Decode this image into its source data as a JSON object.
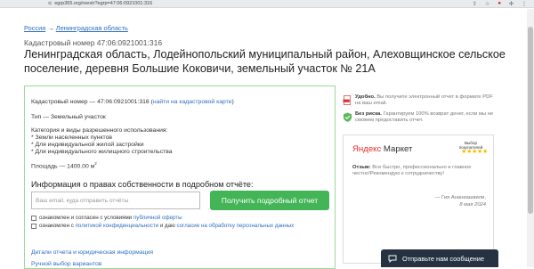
{
  "browser": {
    "url": "egrp365.org/reestr?egrp=47:06:0921001:316",
    "icons": [
      "share-icon",
      "star-icon",
      "extension-red-icon",
      "puzzle-icon",
      "menu-icon"
    ]
  },
  "breadcrumb": {
    "root": "Россия",
    "sep": "→",
    "region": "Ленинградская область"
  },
  "header": {
    "kad_label": "Кадастровый номер 47:06:0921001:316",
    "title": "Ленинградская область, Лодейнопольский муниципальный район, Алеховщинское сельское поселение, деревня Большие Коковичи, земельный участок № 21А"
  },
  "card": {
    "kad_line_prefix": "Кадастровый номер — 47:06:0921001:316 (",
    "kad_line_link": "найти на кадастровой карте",
    "kad_line_suffix": ")",
    "type": "Тип — Земельный участок",
    "category_title": "Категория и виды разрешенного использования:",
    "categories": [
      "* Земли населенных пунктов",
      "* Для индивидуальной жилой застройки",
      "* Для индивидуального жилищного строительства"
    ],
    "area_prefix": "Площадь — 1400.00 м",
    "area_sup": "2",
    "info_title": "Информация о правах собственности в подробном отчёте:",
    "email_placeholder": "Ваш email, куда отправить отчёты",
    "button": "Получить подробный отчет",
    "consent1_text": "ознакомлен и согласен с условиями ",
    "consent1_link": "публичной оферты",
    "consent2_text": "ознакомлен с ",
    "consent2_link1": "политикой конфиденциальности",
    "consent2_mid": " и даю ",
    "consent2_link2": "согласие на обработку персональных данных",
    "details_link": "Детали отчета и юридическая информация",
    "manual_link": "Ручной выбор вариантов"
  },
  "sidebar": {
    "feature1_bold": "Удобно.",
    "feature1_text": " Вы получите электронный отчет в формате PDF на ваш email.",
    "feature2_bold": "Без риска.",
    "feature2_text": " Гарантируем 100% возврат денег, если мы не сможем предоставить отчет.",
    "market": {
      "logo_y": "Яндекс",
      "logo_rest": " Маркет",
      "choice": "Выбор покупателей",
      "stars": "★★★★★",
      "review_bold": "Отзыв:",
      "review_text": " Все быстро, профессионально и главное честно!Рекомендую к сотрудничеству!",
      "author": "— Гия Ананиашвили,",
      "date": "8 мая 2024"
    }
  },
  "chat": {
    "label": "Отправьте нам сообщение"
  },
  "colors": {
    "accent_green": "#43b556",
    "link_blue": "#2f6fc0",
    "chat_bg": "#263242",
    "star": "#f7b900"
  }
}
